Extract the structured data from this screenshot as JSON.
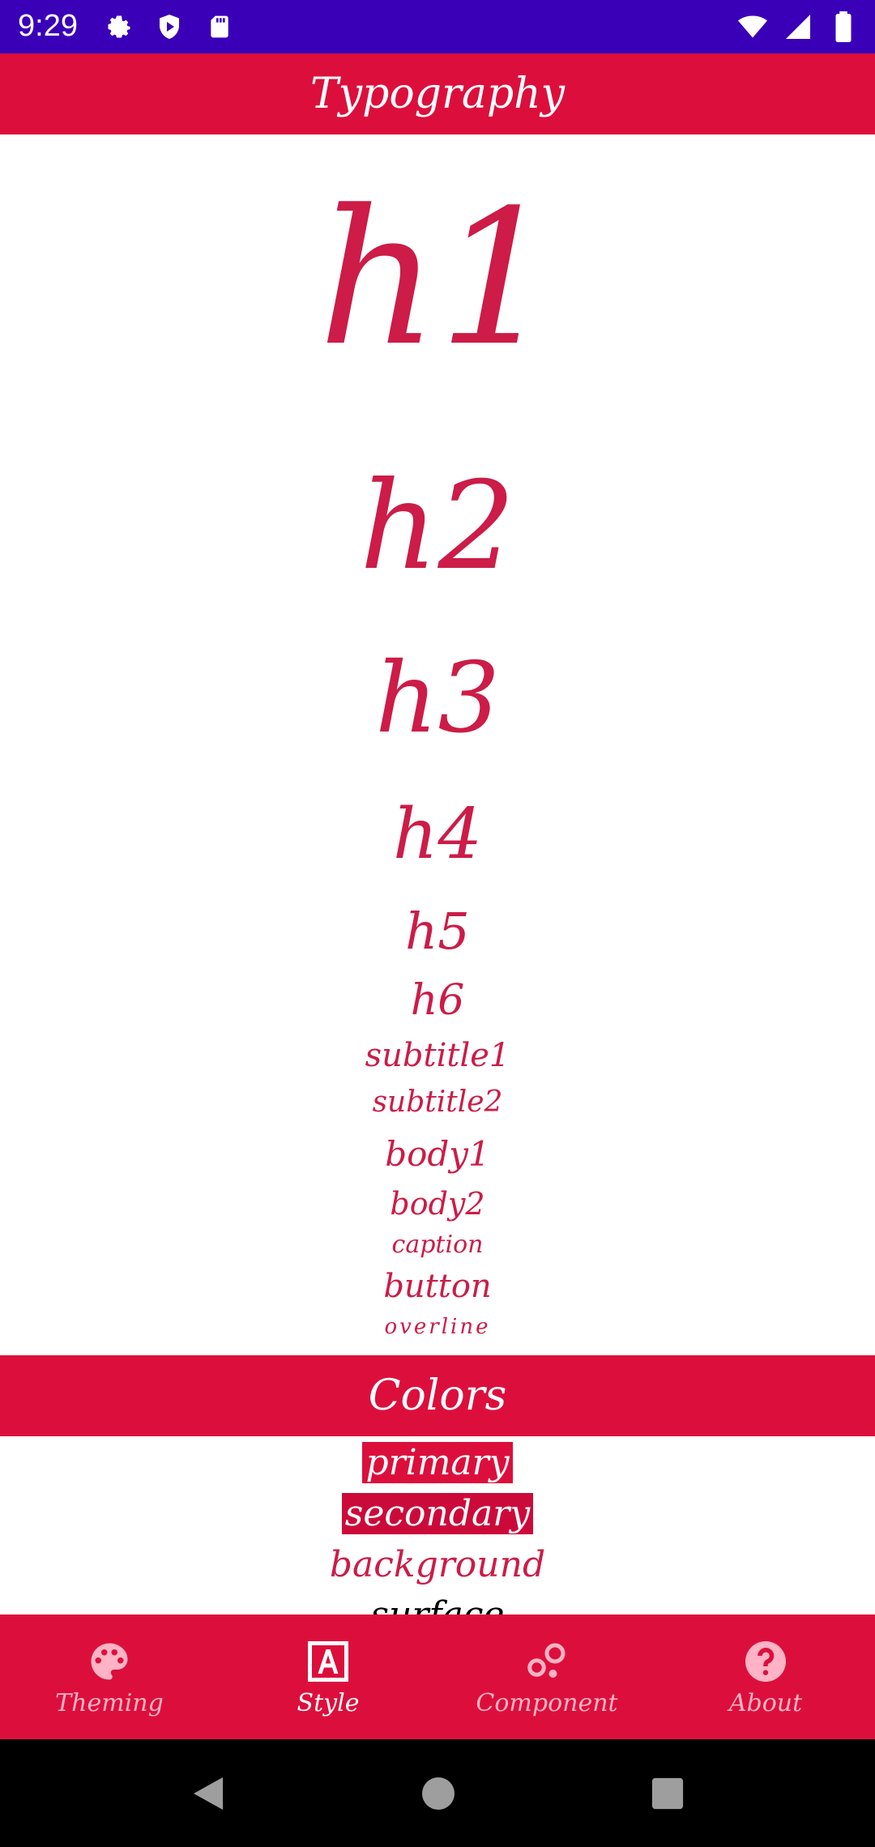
{
  "status_bar": {
    "time": "9:29"
  },
  "typography": {
    "title": "Typography",
    "styles": [
      "h1",
      "h2",
      "h3",
      "h4",
      "h5",
      "h6",
      "subtitle1",
      "subtitle2",
      "body1",
      "body2",
      "caption",
      "button",
      "overline"
    ]
  },
  "colors": {
    "title": "Colors",
    "items": [
      "primary",
      "secondary",
      "background",
      "surface"
    ]
  },
  "bottom_nav": {
    "items": [
      {
        "label": "Theming",
        "icon": "palette-icon"
      },
      {
        "label": "Style",
        "icon": "text-format-icon"
      },
      {
        "label": "Component",
        "icon": "bubbles-icon"
      },
      {
        "label": "About",
        "icon": "help-icon"
      }
    ],
    "active_index": 1
  },
  "theme": {
    "primary": "#dc0f3c",
    "secondary": "#cc0a3a",
    "text_accent": "#cc1c47",
    "status_bar": "#3a00b8"
  }
}
